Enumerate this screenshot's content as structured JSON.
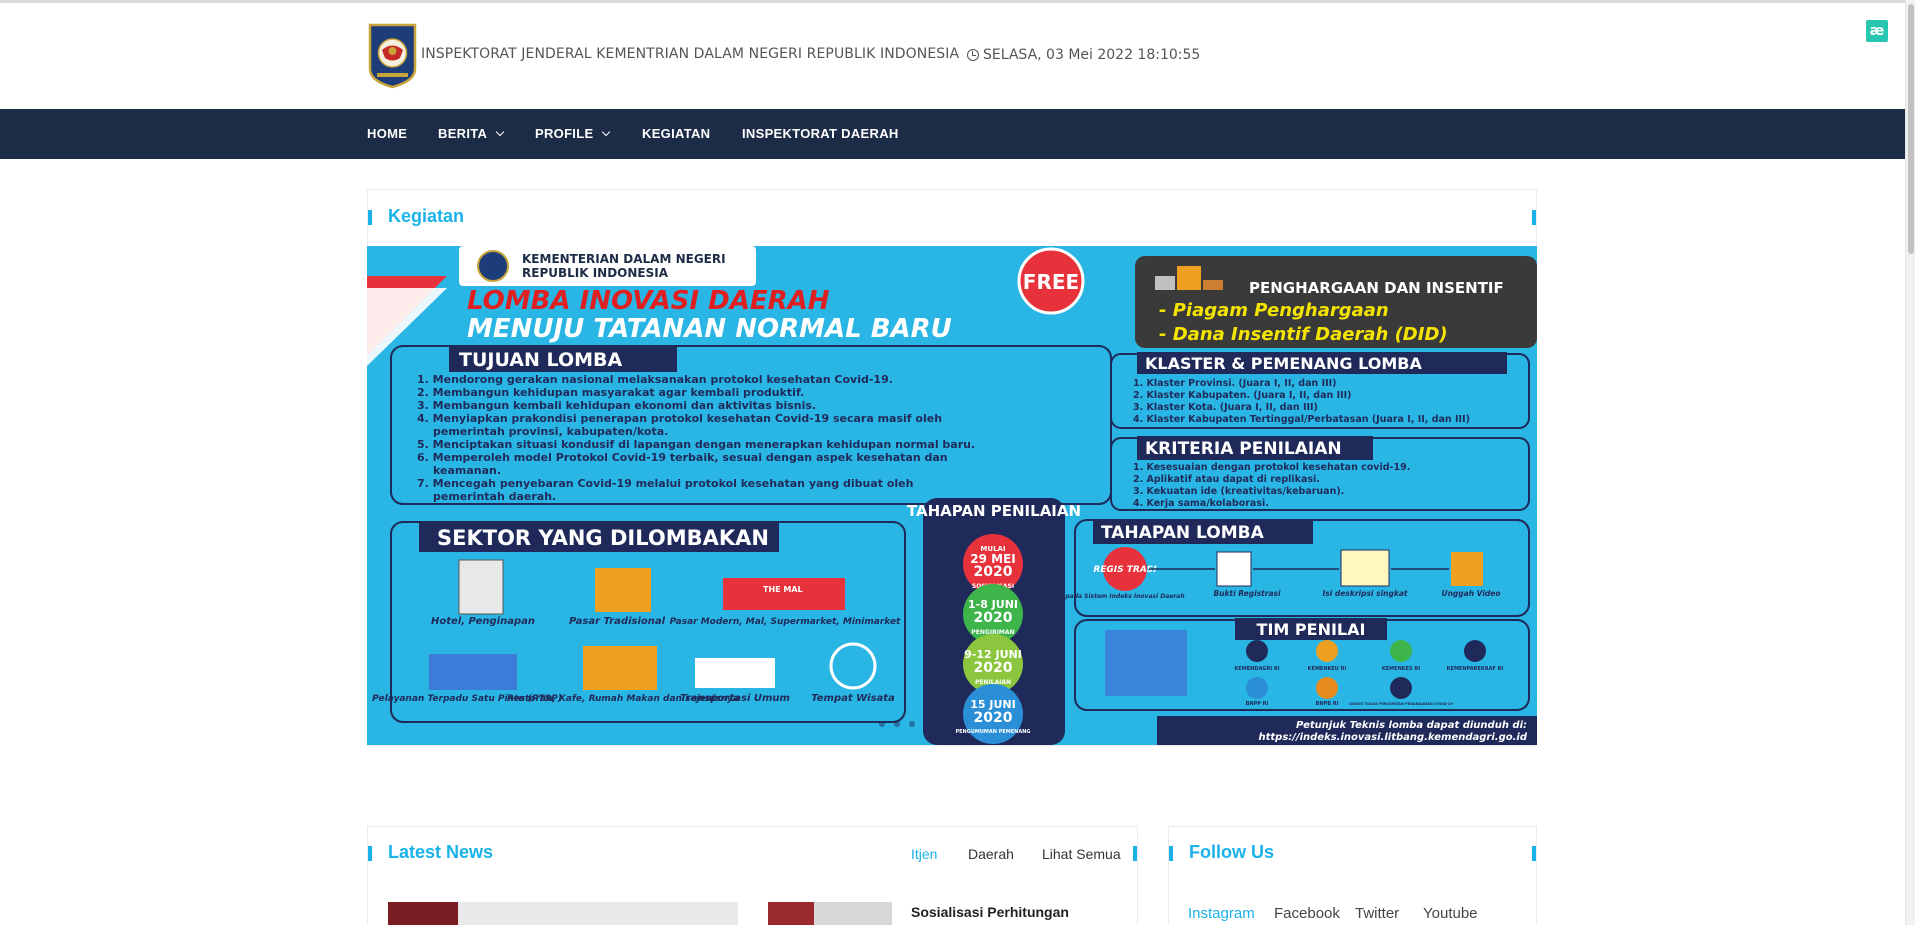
{
  "header": {
    "site_title": "INSPEKTORAT JENDERAL KEMENTRIAN DALAM NEGERI REPUBLIK INDONESIA",
    "datetime": "SELASA, 03 Mei 2022 18:10:55"
  },
  "extension_icon": "æ",
  "nav": {
    "home": "HOME",
    "berita": "BERITA",
    "profile": "PROFILE",
    "kegiatan": "KEGIATAN",
    "inspektorat": "INSPEKTORAT DAERAH"
  },
  "kegiatan": {
    "title": "Kegiatan",
    "banner": {
      "ministry": "KEMENTERIAN DALAM NEGERI",
      "ministry2": "REPUBLIK INDONESIA",
      "free": "FREE",
      "headline1": "LOMBA INOVASI DAERAH",
      "headline2": "MENUJU TATANAN NORMAL BARU",
      "award_title": "PENGHARGAAN DAN INSENTIF",
      "award1": "- Piagam Penghargaan",
      "award2": "- Dana Insentif Daerah (DID)",
      "tujuan_title": "TUJUAN LOMBA",
      "tujuan": [
        "1. Mendorong gerakan nasional melaksanakan protokol kesehatan Covid-19.",
        "2. Membangun kehidupan masyarakat agar kembali produktif.",
        "3. Membangun kembali kehidupan ekonomi dan aktivitas bisnis.",
        "4. Menyiapkan prakondisi  penerapan  protokol kesehatan Covid-19 secara masif oleh",
        "pemerintah provinsi, kabupaten/kota.",
        "5. Menciptakan situasi kondusif di lapangan dengan menerapkan kehidupan normal baru.",
        "6. Memperoleh model Protokol Covid-19 terbaik, sesuai dengan aspek kesehatan dan",
        "keamanan.",
        "7. Mencegah penyebaran Covid-19 melalui protokol kesehatan yang dibuat oleh",
        "pemerintah daerah."
      ],
      "klaster_title": "KLASTER & PEMENANG LOMBA",
      "klaster": [
        "1. Klaster Provinsi. (Juara I, II, dan III)",
        "2. Klaster Kabupaten. (Juara I, II, dan III)",
        "3. Klaster Kota. (Juara I, II, dan III)",
        "4. Klaster Kabupaten Tertinggal/Perbatasan (Juara I, II, dan III)"
      ],
      "kriteria_title": "KRITERIA PENILAIAN",
      "kriteria": [
        "1. Kesesuaian dengan protokol kesehatan covid-19.",
        "2. Aplikatif atau dapat di replikasi.",
        "3. Kekuatan ide (kreativitas/kebaruan).",
        "4. Kerja sama/kolaborasi."
      ],
      "sektor_title": "SEKTOR YANG DILOMBAKAN",
      "sektor": [
        "Hotel, Penginapan",
        "Pasar Tradisional",
        "Pasar Modern, Mal, Supermarket, Minimarket",
        "Pelayanan Terpadu Satu Pintu (PTSP)",
        "Restoran, Kafe, Rumah Makan dan sejenisnya",
        "Transportasi Umum",
        "Tempat Wisata"
      ],
      "mall_sign": "THE MAL",
      "tahapan_penilaian_title": "TAHAPAN PENILAIAN",
      "penilaian": [
        {
          "pre": "MULAI",
          "date": "29 MEI",
          "year": "2020",
          "label": "SOSIALISASI"
        },
        {
          "pre": "",
          "date": "1-8 JUNI",
          "year": "2020",
          "label": "PENGIRIMAN"
        },
        {
          "pre": "",
          "date": "9-12 JUNI",
          "year": "2020",
          "label": "PENILAIAN"
        },
        {
          "pre": "",
          "date": "15 JUNI",
          "year": "2020",
          "label": "PENGUMUMAN PEMENANG"
        }
      ],
      "tahapan_lomba_title": "TAHAPAN LOMBA",
      "regis": "REGIS TRASI",
      "lomba_steps": [
        "pada Sistem Indeks Inovasi Daerah",
        "Bukti Registrasi",
        "Isi deskripsi singkat",
        "Unggah Video"
      ],
      "tim_title": "TIM PENILAI",
      "tim": [
        "KEMENDAGRI RI",
        "KEMENKEU RI",
        "KEMENKES RI",
        "KEMENPAREKRAF RI",
        "BNPP RI",
        "BNPB RI",
        "GUGUS TUGAS PERCEPATAN PENANGANAN COVID-19"
      ],
      "petunjuk1": "Petunjuk Teknis lomba dapat diunduh di:",
      "petunjuk2": "https://indeks.inovasi.litbang.kemendagri.go.id"
    }
  },
  "latest_news": {
    "title": "Latest News",
    "tabs": [
      "Itjen",
      "Daerah",
      "Lihat Semua"
    ],
    "first_item_title": "Sosialisasi Perhitungan"
  },
  "follow_us": {
    "title": "Follow Us",
    "tabs": [
      "Instagram",
      "Facebook",
      "Twitter",
      "Youtube"
    ]
  },
  "colors": {
    "navbar": "#1d2c46",
    "accent": "#1ab2e8",
    "banner_bg": "#2ab6e4",
    "banner_dark": "#1f2a5a",
    "headline_red": "#e02020"
  }
}
